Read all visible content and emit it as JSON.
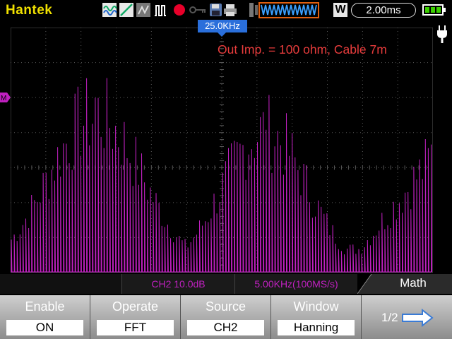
{
  "header": {
    "brand": "Hantek",
    "mode_letter": "W",
    "timebase": "2.00ms"
  },
  "screen": {
    "trigger_position": "25.0KHz",
    "annotation": "Out Imp. = 100 ohm, Cable 7m",
    "trace_color": "#c020c0",
    "annotation_color": "#e83c3c"
  },
  "status": {
    "channel_scale": "CH2 10.0dB",
    "sample_rate": "5.00KHz(100MS/s)"
  },
  "menu": {
    "title": "Math",
    "buttons": [
      {
        "label": "Enable",
        "value": "ON"
      },
      {
        "label": "Operate",
        "value": "FFT"
      },
      {
        "label": "Source",
        "value": "CH2"
      },
      {
        "label": "Window",
        "value": "Hanning"
      }
    ],
    "page": "1/2"
  }
}
